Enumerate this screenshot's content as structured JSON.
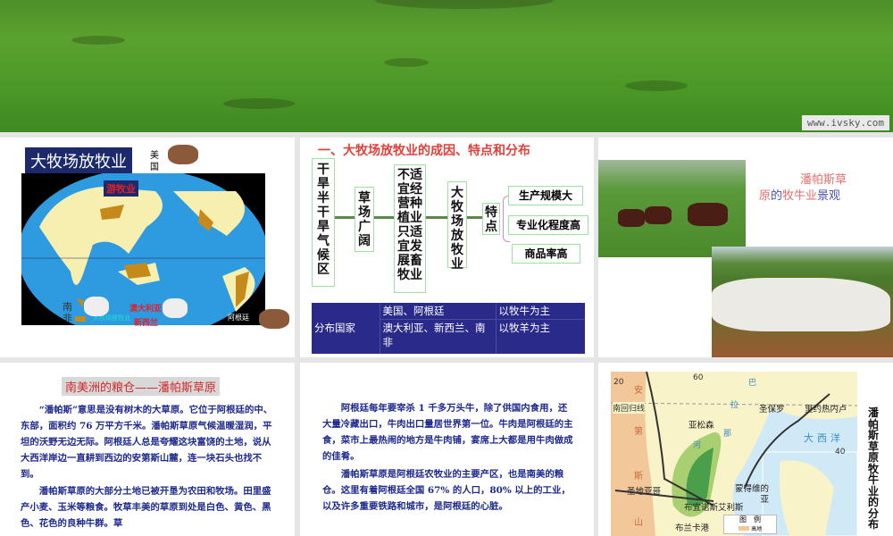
{
  "hero": {
    "watermark": "www.ivsky.com"
  },
  "panel1": {
    "title": "大牧场放牧业",
    "nomadic_label": "游牧业",
    "legend_label": "大牧场放牧业",
    "labels": {
      "usa": "美国",
      "argentina": "阿根廷",
      "australia": "澳大利亚",
      "new_zealand": "新西兰",
      "south_africa": "南非"
    }
  },
  "panel2": {
    "heading": "一、大牧场放牧业的成因、特点和分布",
    "flow": [
      "干旱半干旱气候区",
      "草场广阔",
      "不适宜经营种植业只适宜发展畜牧业",
      "大牧场放牧业",
      "特点"
    ],
    "features": [
      "生产规模大",
      "专业化程度高",
      "商品率高"
    ],
    "table": {
      "header": "分布国家",
      "rows": [
        [
          "美国、阿根廷",
          "以牧牛为主"
        ],
        [
          "澳大利亚、新西兰、南非",
          "以牧羊为主"
        ]
      ]
    }
  },
  "panel3": {
    "caption_line1": "潘帕斯草",
    "caption_line2_a": "原",
    "caption_line2_b": "的",
    "caption_line2_c": "牧牛业",
    "caption_line2_d": "景观"
  },
  "panel4": {
    "title": "南美洲的粮仓——潘帕斯草原",
    "p1": "“潘帕斯”意思是没有树木的大草原。它位于阿根廷的中、东部，面积约 76 万平方千米。潘帕斯草原气候温暖湿润，平坦的沃野无边无际。阿根廷人总是夸耀这块富饶的土地，说从大西洋岸边一直耕到西边的安第斯山麓，连一块石头也找不到。",
    "p2": "潘帕斯草原的大部分土地已被开垦为农田和牧场。田里盛产小麦、玉米等粮食。牧草丰美的草原到处是白色、黄色、黑色、花色的良种牛群。草"
  },
  "panel5": {
    "p1": "阿根廷每年要宰杀 1 千多万头牛，除了供国内食用，还大量冷藏出口，牛肉出口量居世界第一位。牛肉是阿根廷的主食，菜市上最热闹的地方是牛肉铺，宴席上大都是用牛肉做成的佳肴。",
    "p2": "潘帕斯草原是阿根廷农牧业的主要产区，也是南美的粮仓。这里有着阿根廷全国 67% 的人口，80% 以上的工业，以及许多重要铁路和城市，是阿根廷的心脏。"
  },
  "panel6": {
    "side_title": "潘帕斯草原牧牛业的分布",
    "map": {
      "lat20": "20",
      "lon60": "60",
      "lon40": "40",
      "tropic": "南回归线",
      "andes": [
        "安",
        "第",
        "斯",
        "山"
      ],
      "river": [
        "巴",
        "拉",
        "那",
        "河"
      ],
      "cities": [
        "亚松森",
        "圣保罗",
        "里约热内卢",
        "圣地亚哥",
        "布宜诺斯艾利斯",
        "蒙得维的亚",
        "布兰卡港"
      ],
      "ocean": "大西洋",
      "legend": "图　例",
      "legend_item": "高地"
    }
  }
}
